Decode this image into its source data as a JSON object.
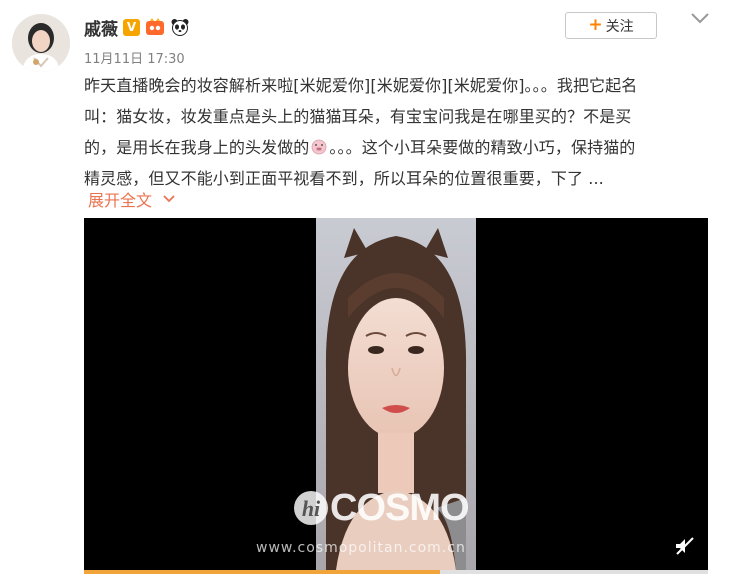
{
  "post": {
    "username": "戚薇",
    "verified_badge": "V",
    "badge_icons": [
      "vip-badge-icon",
      "panda-icon"
    ],
    "timestamp": "11月11日 17:30",
    "text_lines": [
      "昨天直播晚会的妆容解析来啦[米妮爱你][米妮爱你][米妮爱你]。。。我把它起名",
      "叫：猫女妆，妆发重点是头上的猫猫耳朵，有宝宝问我是在哪里买的？不是买",
      "的，是用长在我身上的头发做的",
      "。。。这个小耳朵要做的精致小巧，保持猫的",
      "精灵感，但又不能小到正面平视看不到，所以耳朵的位置很重要，下了 ..."
    ],
    "expand_label": "展开全文"
  },
  "header": {
    "follow_plus": "+",
    "follow_label": "关注"
  },
  "video": {
    "watermark_logo": "COSMO",
    "watermark_prefix": "hi",
    "watermark_url": "www.cosmopolitan.com.cn",
    "progress": 0.57
  },
  "colors": {
    "accent_orange": "#ff8200",
    "link": "#eb7350",
    "badge_gold": "#f6a400",
    "video_bg": "#000000",
    "progress": "#f0a43a"
  }
}
